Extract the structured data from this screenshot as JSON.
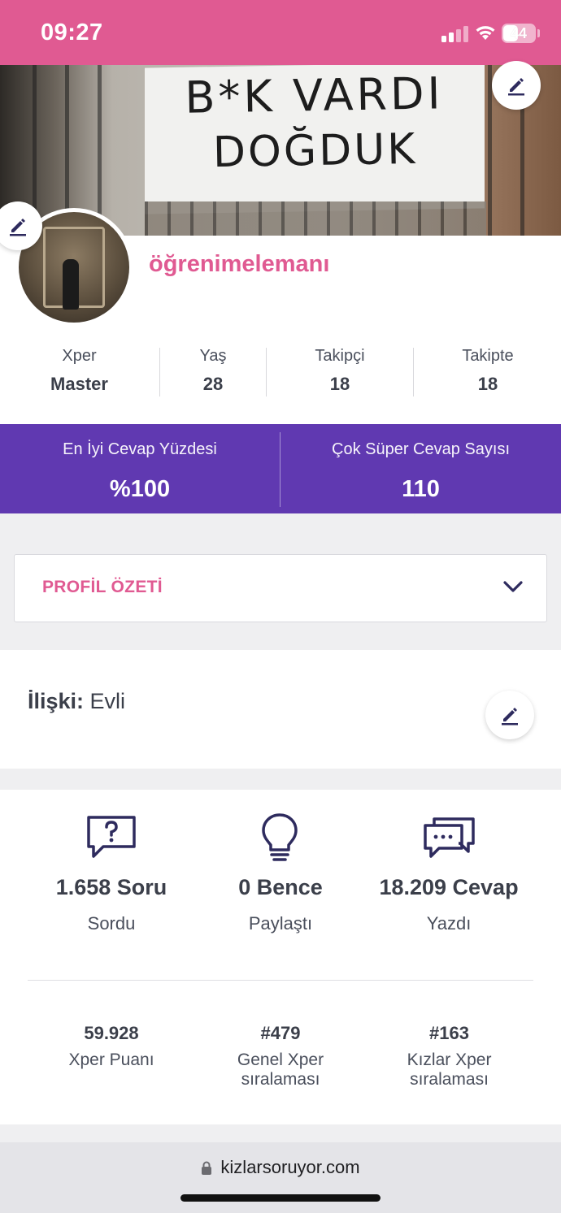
{
  "status_bar": {
    "time": "09:27",
    "battery": "44",
    "color": "#e05a92"
  },
  "cover": {
    "line1": "B*K VARDI",
    "line2": "DOĞDUK"
  },
  "profile": {
    "username": "öğrenimelemanı",
    "stats": [
      {
        "label": "Xper",
        "value": "Master"
      },
      {
        "label": "Yaş",
        "value": "28"
      },
      {
        "label": "Takipçi",
        "value": "18"
      },
      {
        "label": "Takipte",
        "value": "18"
      }
    ]
  },
  "highlights": [
    {
      "label": "En İyi Cevap Yüzdesi",
      "value": "%100"
    },
    {
      "label": "Çok Süper Cevap Sayısı",
      "value": "110"
    }
  ],
  "summary": {
    "title": "PROFİL ÖZETİ"
  },
  "relation": {
    "key": "İlişki:",
    "value": "Evli"
  },
  "activity": [
    {
      "icon": "question-bubble-icon",
      "count": "1.658 Soru",
      "caption": "Sordu"
    },
    {
      "icon": "lightbulb-icon",
      "count": "0 Bence",
      "caption": "Paylaştı"
    },
    {
      "icon": "chat-bubbles-icon",
      "count": "18.209 Cevap",
      "caption": "Yazdı"
    }
  ],
  "ranks": [
    {
      "value": "59.928",
      "caption": "Xper Puanı"
    },
    {
      "value": "#479",
      "caption": "Genel Xper sıralaması"
    },
    {
      "value": "#163",
      "caption": "Kızlar Xper sıralaması"
    }
  ],
  "browser": {
    "url": "kizlarsoruyor.com"
  },
  "colors": {
    "accent_pink": "#e05a92",
    "accent_purple": "#6039b1",
    "icon_navy": "#2e2b5e"
  }
}
